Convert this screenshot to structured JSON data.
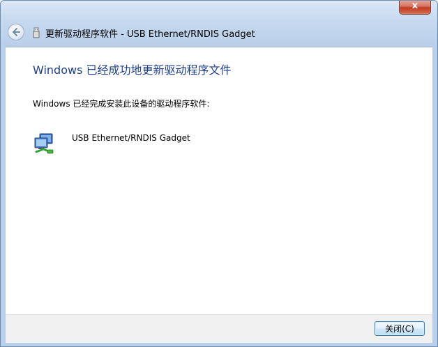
{
  "window": {
    "close_glyph": "x"
  },
  "nav": {
    "title": "更新驱动程序软件 - USB Ethernet/RNDIS Gadget",
    "back_icon": "back-arrow-icon",
    "device_icon": "usb-device-icon"
  },
  "main": {
    "heading": "Windows 已经成功地更新驱动程序文件",
    "message": "Windows 已经完成安装此设备的驱动程序软件:",
    "device": {
      "icon": "network-adapter-icon",
      "name": "USB Ethernet/RNDIS Gadget"
    }
  },
  "footer": {
    "close_label": "关闭(C)"
  },
  "colors": {
    "heading": "#1e3f8c",
    "chrome": "#b9cfe9",
    "close_button_red": "#c23a22",
    "button_border": "#3c7fb1"
  }
}
